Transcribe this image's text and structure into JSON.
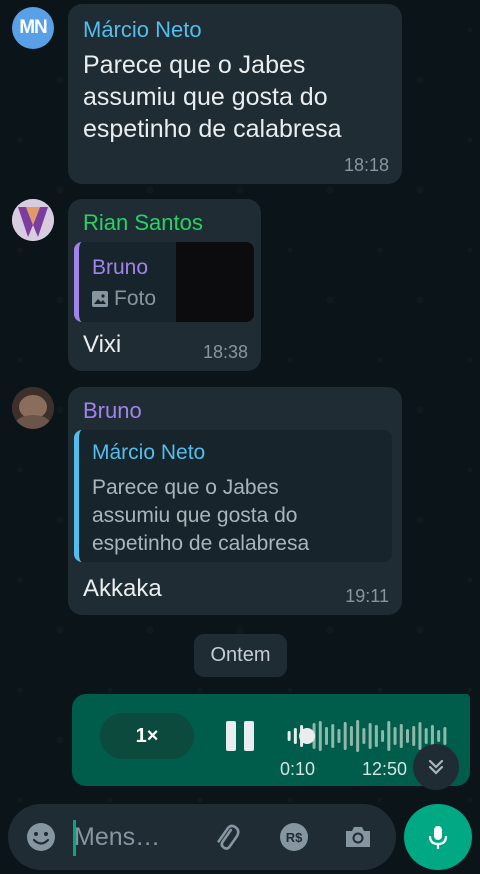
{
  "messages": [
    {
      "avatar_initials": "MN",
      "sender": "Márcio Neto",
      "sender_color": "#53bdeb",
      "lines": [
        "Parece que o Jabes",
        "assumiu que gosta do",
        "espetinho de calabresa"
      ],
      "time": "18:18"
    },
    {
      "sender": "Rian Santos",
      "sender_color": "#25d366",
      "quote": {
        "author": "Bruno",
        "author_color": "#a084ea",
        "media_icon": "photo-icon",
        "media_label": "Foto"
      },
      "text": "Vixi",
      "time": "18:38"
    },
    {
      "sender": "Bruno",
      "sender_color": "#a084ea",
      "quote": {
        "author": "Márcio Neto",
        "author_color": "#53bdeb",
        "lines": [
          "Parece que o Jabes",
          "assumiu que gosta do",
          "espetinho de calabresa"
        ]
      },
      "text": "Akkaka",
      "time": "19:11"
    }
  ],
  "day_divider": "Ontem",
  "voice_note": {
    "speed": "1×",
    "elapsed": "0:10",
    "time": "12:50",
    "progress": 0.13,
    "bubble_color": "#005c4b"
  },
  "composer": {
    "placeholder": "Mens…",
    "icons": [
      "emoji-icon",
      "attach-icon",
      "payment-icon",
      "camera-icon",
      "mic-icon"
    ]
  }
}
